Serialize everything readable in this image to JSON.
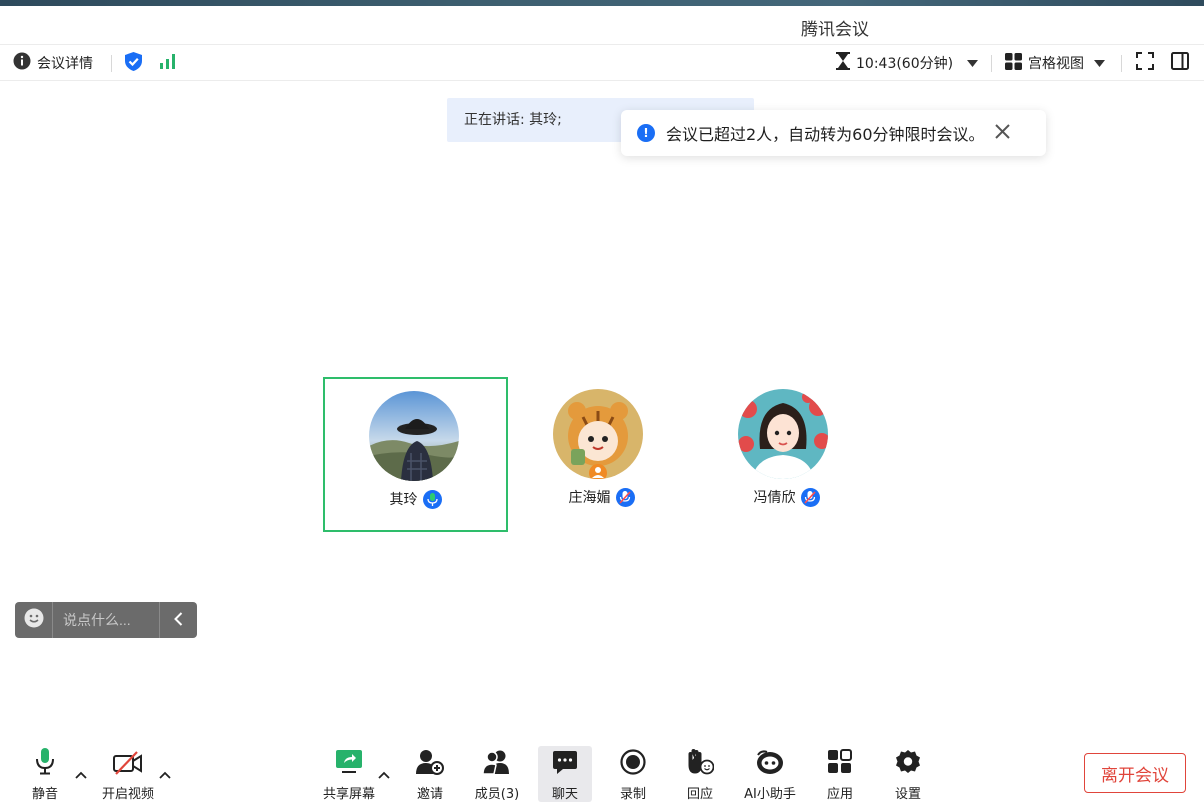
{
  "window": {
    "title": "腾讯会议"
  },
  "toolbar": {
    "meeting_details_label": "会议详情",
    "timer": "10:43(60分钟)",
    "view_label": "宫格视图"
  },
  "speaking": {
    "text": "正在讲话: 其玲;"
  },
  "notice": {
    "text": "会议已超过2人，自动转为60分钟限时会议。"
  },
  "participants": [
    {
      "name": "其玲"
    },
    {
      "name": "庄海媚"
    },
    {
      "name": "冯倩欣"
    }
  ],
  "chat": {
    "placeholder": "说点什么..."
  },
  "bottom": {
    "mute": "静音",
    "video": "开启视频",
    "share": "共享屏幕",
    "invite": "邀请",
    "members": "成员(3)",
    "chat": "聊天",
    "record": "录制",
    "react": "回应",
    "ai": "AI小助手",
    "apps": "应用",
    "settings": "设置",
    "leave": "离开会议"
  },
  "colors": {
    "accent": "#1a6ef5",
    "active_border": "#2ebd6b",
    "leave": "#e0453b",
    "mic_green": "#27b26b"
  }
}
